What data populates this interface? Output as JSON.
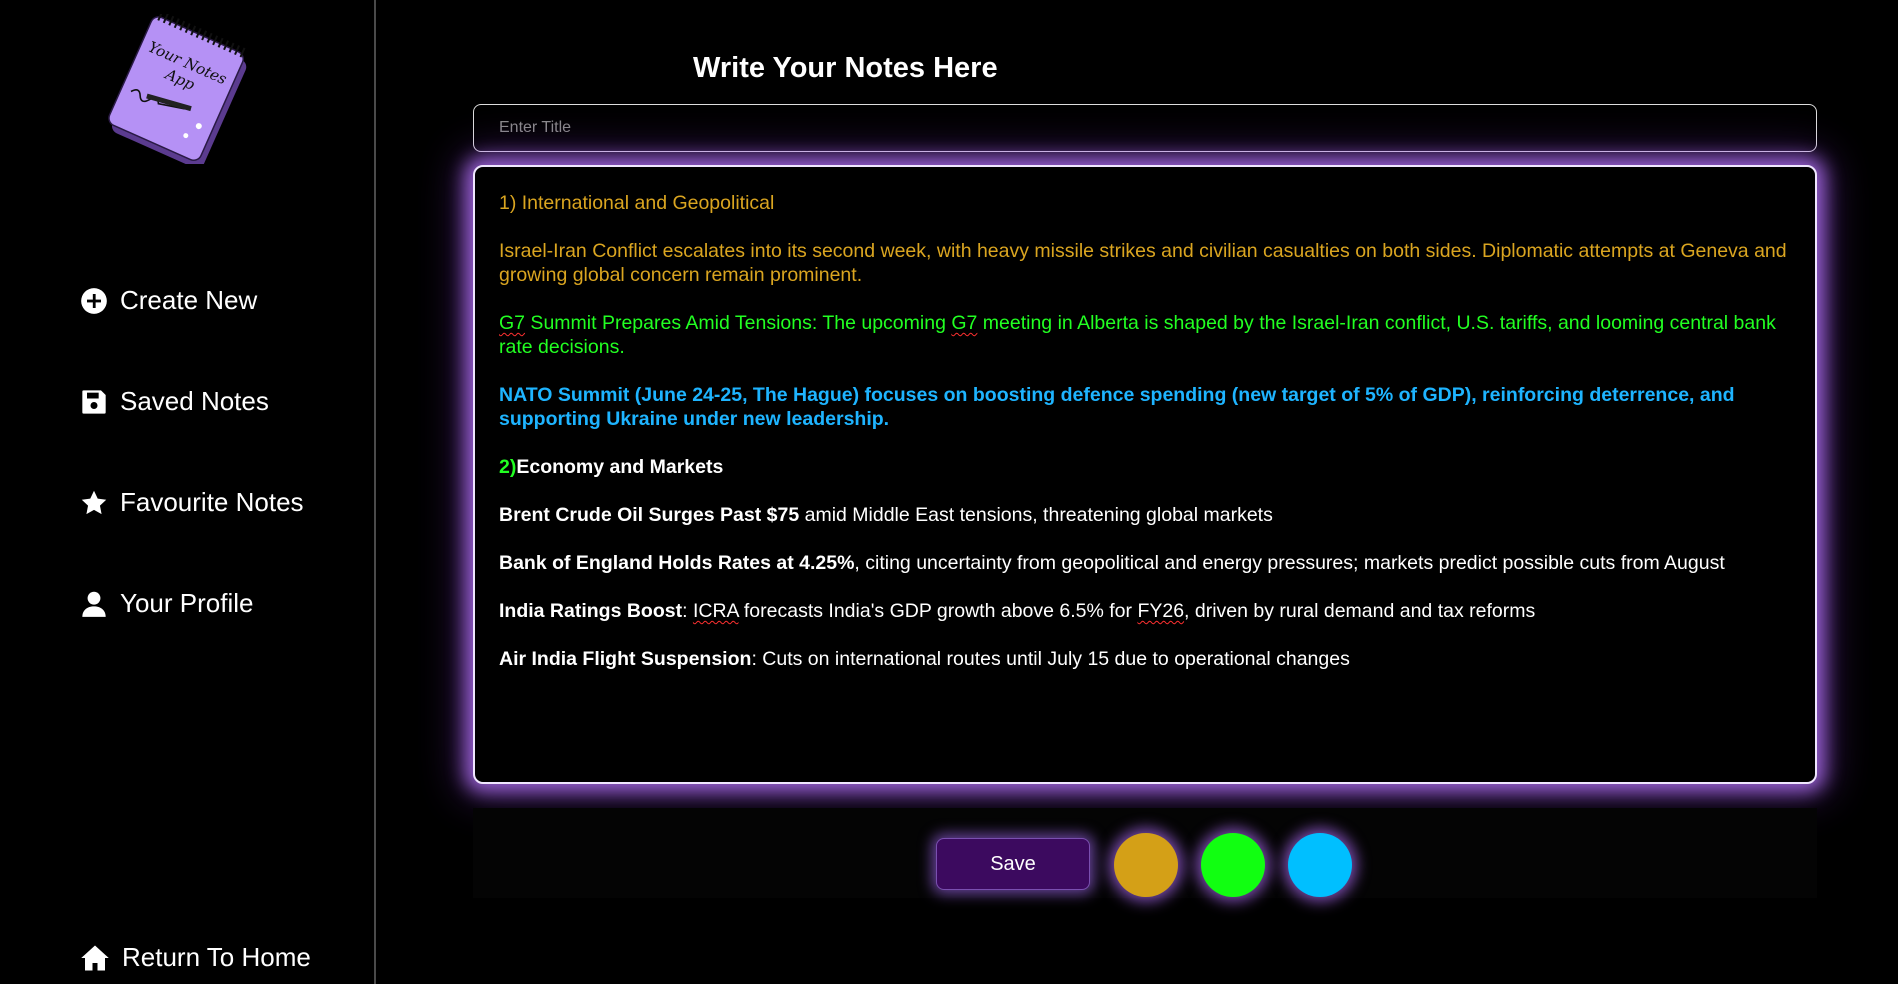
{
  "logo": {
    "line1": "Your Notes",
    "line2": "App"
  },
  "sidebar": {
    "items": [
      {
        "label": "Create New",
        "icon": "plus-circle-icon"
      },
      {
        "label": "Saved Notes",
        "icon": "floppy-disk-icon"
      },
      {
        "label": "Favourite Notes",
        "icon": "star-icon"
      },
      {
        "label": "Your Profile",
        "icon": "user-icon"
      }
    ],
    "home": {
      "label": "Return To Home",
      "icon": "home-icon"
    }
  },
  "main": {
    "title": "Write Your Notes Here",
    "title_placeholder": "Enter Title"
  },
  "note": {
    "section1_heading": "1) International and Geopolitical",
    "p1": "Israel-Iran Conflict escalates into its second week, with heavy missile strikes and civilian casualties on both sides. Diplomatic attempts at Geneva and growing global concern remain prominent.",
    "p2_w1": "G7",
    "p2_a": " Summit Prepares Amid Tensions: The upcoming ",
    "p2_w2": "G7",
    "p2_b": " meeting in Alberta is shaped by the Israel-Iran conflict, U.S. tariffs, and looming central bank rate decisions.",
    "p3": "NATO Summit (June 24-25, The Hague) focuses on boosting defence spending (new target of 5% of GDP), reinforcing deterrence, and supporting Ukraine under new leadership.",
    "section2_num": "2)",
    "section2_heading": "Economy and Markets",
    "p4_bold": "Brent Crude Oil Surges Past $75",
    "p4_rest": " amid Middle East tensions, threatening global markets",
    "p5_bold": "Bank of England Holds Rates at 4.25%",
    "p5_rest": ", citing uncertainty from geopolitical and energy pressures; markets predict possible cuts from August",
    "p6_bold": "India Ratings Boost",
    "p6_a": ": ",
    "p6_w1": "ICRA",
    "p6_b": " forecasts India's GDP growth above 6.5% for ",
    "p6_w2": "FY26",
    "p6_c": ", driven by rural demand and tax reforms",
    "p7_bold": "Air India Flight Suspension",
    "p7_rest": ": Cuts on international routes until July 15 due to operational changes"
  },
  "toolbar": {
    "save_label": "Save",
    "colors": [
      "#d4a017",
      "#11ff11",
      "#00bfff"
    ]
  }
}
